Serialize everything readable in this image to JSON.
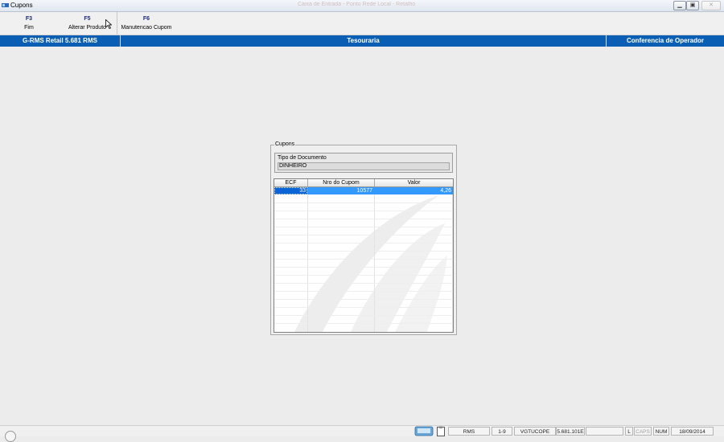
{
  "window": {
    "title": "Cupons",
    "ghost_title": "Caixa de Entrada - Ponto Rede Local - Retalho",
    "min_icon": "minimize-icon",
    "max_icon": "restore-icon",
    "close_icon": "close-icon"
  },
  "toolbar": {
    "items": [
      {
        "key": "F3",
        "label": "Fim"
      },
      {
        "key": "F5",
        "label": "Alterar Produto"
      },
      {
        "key": "F6",
        "label": "Manutencao Cupom"
      }
    ]
  },
  "header": {
    "left": "G-RMS Retail 5.681 RMS",
    "center": "Tesouraria",
    "right": "Conferencia de Operador",
    "color": "#0a5fb4"
  },
  "cupons": {
    "legend": "Cupons",
    "tipo_label": "Tipo de Documento",
    "tipo_value": "DINHEIRO",
    "columns": [
      "ECF",
      "Nro do Cupom",
      "Valor"
    ],
    "rows": [
      {
        "ecf": "33",
        "cupom": "10577",
        "valor": "4,26"
      }
    ],
    "selection_color": "#3399ff"
  },
  "statusbar": {
    "rms": "RMS",
    "range": "1-9",
    "program": "VGTUCOPE",
    "version": "5.681.101E",
    "empty": "",
    "l": "L",
    "caps": "CAPS",
    "num": "NUM",
    "date": "18/09/2014"
  }
}
